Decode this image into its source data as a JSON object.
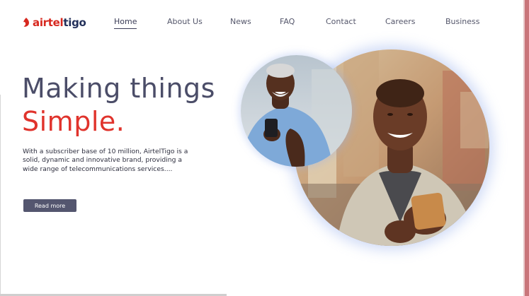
{
  "brand": {
    "logo_part1": "airtel",
    "logo_part2": "tigo"
  },
  "nav": {
    "items": [
      {
        "label": "Home",
        "active": true
      },
      {
        "label": "About Us"
      },
      {
        "label": "News"
      },
      {
        "label": "FAQ"
      },
      {
        "label": "Contact"
      },
      {
        "label": "Careers"
      },
      {
        "label": "Business"
      }
    ]
  },
  "hero": {
    "title_line1": "Making things",
    "title_line2": "Simple.",
    "description": "With a subscriber base of 10 million, AirtelTigo is a solid, dynamic and innovative brand, providing a wide range of telecommunications services....",
    "button_label": "Read more"
  },
  "colors": {
    "accent_red": "#e0332c",
    "heading_dark": "#4b4d68",
    "button_bg": "#54566f"
  },
  "icons": {
    "logo_mark": "flame-icon"
  }
}
